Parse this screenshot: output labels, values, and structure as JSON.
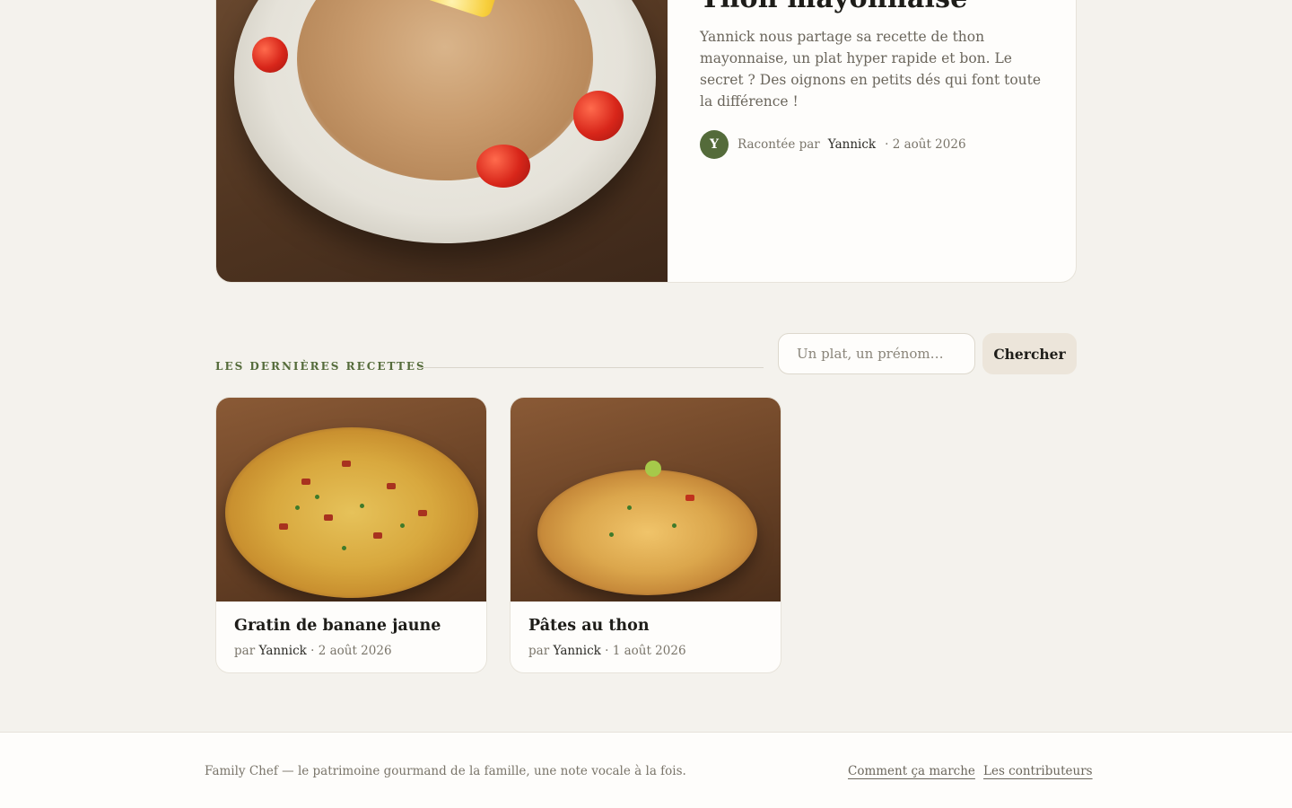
{
  "featured": {
    "title": "Thon mayonnaise",
    "description": "Yannick nous partage sa recette de thon mayonnaise, un plat hyper rapide et bon. Le secret ? Des oignons en petits dés qui font toute la différence !",
    "avatar_initial": "Y",
    "told_by_label": "Racontée par",
    "author": "Yannick",
    "date": "· 2 août 2026"
  },
  "section": {
    "label": "Les dernières recettes"
  },
  "search": {
    "placeholder": "Un plat, un prénom…",
    "button_label": "Chercher"
  },
  "recipes": [
    {
      "title": "Gratin de banane jaune",
      "by_label": "par",
      "author": "Yannick",
      "date": "· 2 août 2026"
    },
    {
      "title": "Pâtes au thon",
      "by_label": "par",
      "author": "Yannick",
      "date": "· 1 août 2026"
    }
  ],
  "footer": {
    "tagline": "Family Chef — le patrimoine gourmand de la famille, une note vocale à la fois.",
    "links": [
      "Comment ça marche",
      "Les contributeurs"
    ]
  },
  "colors": {
    "background": "#f4f2ed",
    "accent_green": "#546b3a",
    "card": "#fefdfb",
    "button": "#ece5da"
  }
}
